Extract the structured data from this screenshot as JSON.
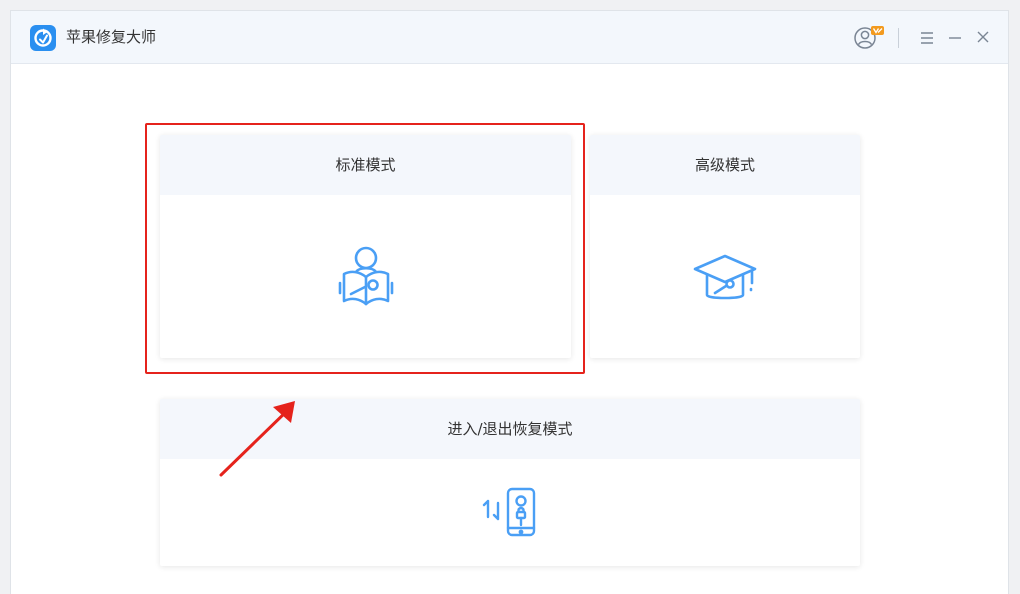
{
  "window": {
    "title": "苹果修复大师"
  },
  "titlebar": {
    "icons": [
      "app-logo-icon",
      "user-avatar-icon",
      "menu-icon",
      "minimize-icon",
      "close-icon"
    ]
  },
  "modes": [
    {
      "label": "标准模式",
      "icon": "book-repair-icon",
      "highlighted": true
    },
    {
      "label": "高级模式",
      "icon": "graduation-cap-icon",
      "highlighted": false
    },
    {
      "label": "进入/退出恢复模式",
      "icon": "phone-recovery-icon",
      "highlighted": false
    }
  ],
  "colors": {
    "accent": "#2a8ff0",
    "icon_blue": "#4a9ff5",
    "highlight_red": "#e5231c",
    "badge_orange": "#f39a1e",
    "card_header_bg": "#f4f7fc",
    "titlebar_bg": "#f3f7fc"
  }
}
